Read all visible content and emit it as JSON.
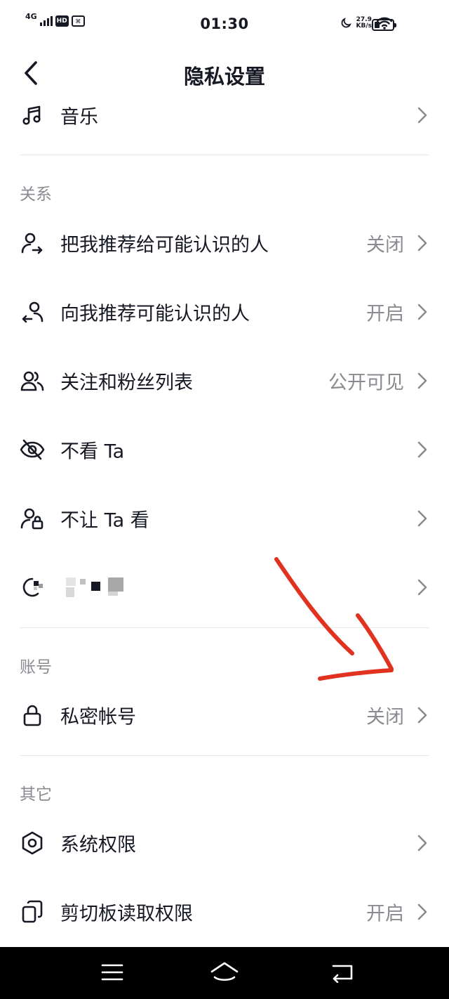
{
  "status_bar": {
    "network": "4G",
    "hd_badge": "HD",
    "time": "01:30",
    "speed_value": "27.9",
    "speed_unit": "KB/s"
  },
  "header": {
    "title": "隐私设置"
  },
  "rows": {
    "music": {
      "label": "音乐",
      "icon": "music-note-icon"
    },
    "recommend_me": {
      "label": "把我推荐给可能认识的人",
      "value": "关闭",
      "icon": "user-share-icon"
    },
    "recommend_to_me": {
      "label": "向我推荐可能认识的人",
      "value": "开启",
      "icon": "user-recommend-icon"
    },
    "follow_list": {
      "label": "关注和粉丝列表",
      "value": "公开可见",
      "icon": "users-icon"
    },
    "not_view": {
      "label": "不看 Ta",
      "icon": "eye-off-icon"
    },
    "not_let_view": {
      "label": "不让 Ta 看",
      "icon": "user-lock-icon"
    },
    "blurred": {
      "icon": "blurred-icon"
    },
    "private_account": {
      "label": "私密帐号",
      "value": "关闭",
      "icon": "lock-icon"
    },
    "system_permissions": {
      "label": "系统权限",
      "icon": "hexagon-icon"
    },
    "clipboard": {
      "label": "剪切板读取权限",
      "value": "开启",
      "icon": "clipboard-icon"
    }
  },
  "sections": {
    "relations": "关系",
    "account": "账号",
    "other": "其它"
  },
  "colors": {
    "text": "#161823",
    "secondary": "#8a8b91",
    "annotation": "#e0321f",
    "divider": "#e8e8ea"
  }
}
